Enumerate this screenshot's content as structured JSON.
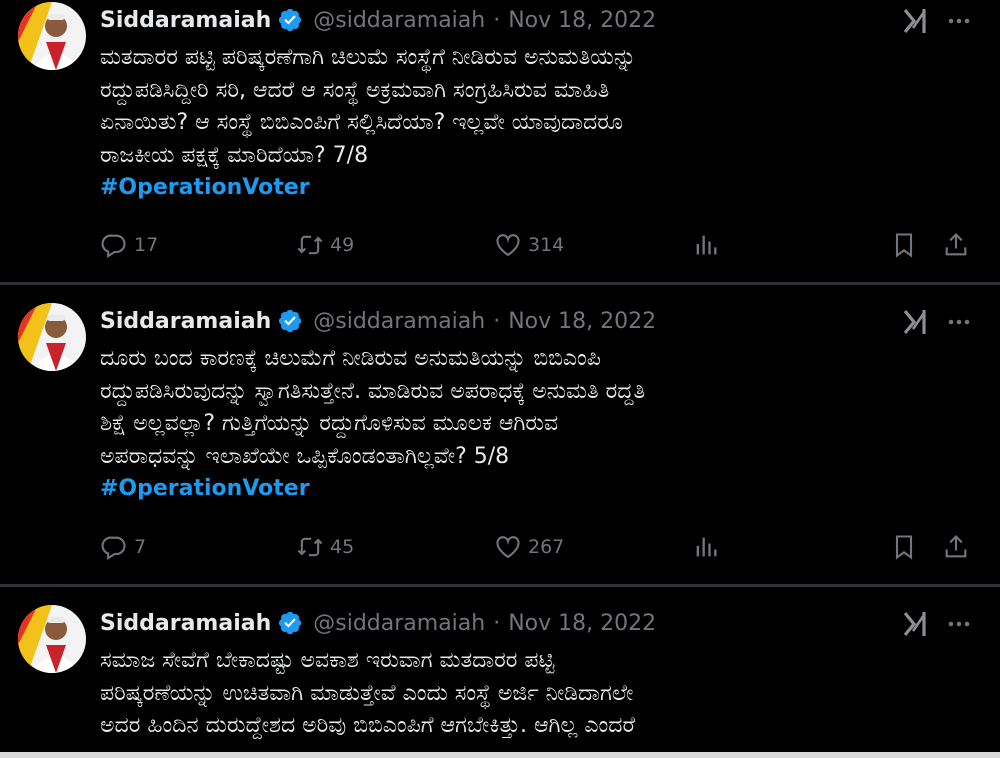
{
  "tweets": [
    {
      "name": "Siddaramaiah",
      "handle": "@siddaramaiah",
      "separator": "·",
      "date": "Nov 18, 2022",
      "lines": [
        "ಮತದಾರರ ಪಟ್ಟಿ ಪರಿಷ್ಕರಣೆಗಾಗಿ ಚಿಲುಮೆ ಸಂಸ್ಥೆಗೆ ನೀಡಿರುವ ಅನುಮತಿಯನ್ನು",
        "ರದ್ದುಪಡಿಸಿದ್ದೀರಿ ಸರಿ, ಆದರೆ ಆ ಸಂಸ್ಥೆ ಅಕ್ರಮವಾಗಿ ಸಂಗ್ರಹಿಸಿರುವ ಮಾಹಿತಿ",
        "ಏನಾಯಿತು? ಆ ಸಂಸ್ಥೆ ಬಿಬಿಎಂಪಿಗೆ ಸಲ್ಲಿಸಿದೆಯಾ? ಇಲ್ಲವೇ ಯಾವುದಾದರೂ",
        "ರಾಜಕೀಯ ಪಕ್ಷಕ್ಕೆ ಮಾರಿದೆಯಾ? 7/8"
      ],
      "hashtag": "#OperationVoter",
      "replies": "17",
      "retweets": "49",
      "likes": "314"
    },
    {
      "name": "Siddaramaiah",
      "handle": "@siddaramaiah",
      "separator": "·",
      "date": "Nov 18, 2022",
      "lines": [
        "ದೂರು ಬಂದ ಕಾರಣಕ್ಕೆ ಚಿಲುಮೆಗೆ ನೀಡಿರುವ ಅನುಮತಿಯನ್ನು ಬಿಬಿಎಂಪಿ",
        "ರದ್ದುಪಡಿಸಿರುವುದನ್ನು ಸ್ವಾಗತಿಸುತ್ತೇನೆ. ಮಾಡಿರುವ ಅಪರಾಧಕ್ಕೆ ಅನುಮತಿ ರದ್ದತಿ",
        "ಶಿಕ್ಷೆ ಅಲ್ಲವಲ್ಲಾ? ಗುತ್ತಿಗೆಯನ್ನು ರದ್ದುಗೊಳಿಸುವ ಮೂಲಕ ಆಗಿರುವ",
        "ಅಪರಾಧವನ್ನು ಇಲಾಖೆಯೇ ಒಪ್ಪಿಕೊಂಡಂತಾಗಿಲ್ಲವೇ? 5/8"
      ],
      "hashtag": "#OperationVoter",
      "replies": "7",
      "retweets": "45",
      "likes": "267"
    },
    {
      "name": "Siddaramaiah",
      "handle": "@siddaramaiah",
      "separator": "·",
      "date": "Nov 18, 2022",
      "lines": [
        "ಸಮಾಜ ಸೇವೆಗೆ ಬೇಕಾದಷ್ಟು ಅವಕಾಶ ಇರುವಾಗ ಮತದಾರರ ಪಟ್ಟಿ",
        "ಪರಿಷ್ಕರಣೆಯನ್ನು ಉಚಿತವಾಗಿ ಮಾಡುತ್ತೇವೆ ಎಂದು ಸಂಸ್ಥೆ ಅರ್ಜಿ ನೀಡಿದಾಗಲೇ",
        "ಅದರ ಹಿಂದಿನ ದುರುದ್ದೇಶದ ಅರಿವು ಬಿಬಿಎಂಪಿಗೆ ಆಗಬೇಕಿತ್ತು. ಆಗಿಲ್ಲ ಎಂದರೆ"
      ]
    }
  ],
  "colors": {
    "background": "#000000",
    "text": "#e7e9ea",
    "muted": "#71767b",
    "accent": "#1d9bf0",
    "divider": "#2f3336"
  },
  "icons": [
    "verified-badge-icon",
    "grok-icon",
    "more-icon",
    "reply-icon",
    "retweet-icon",
    "like-icon",
    "views-icon",
    "bookmark-icon",
    "share-icon"
  ]
}
